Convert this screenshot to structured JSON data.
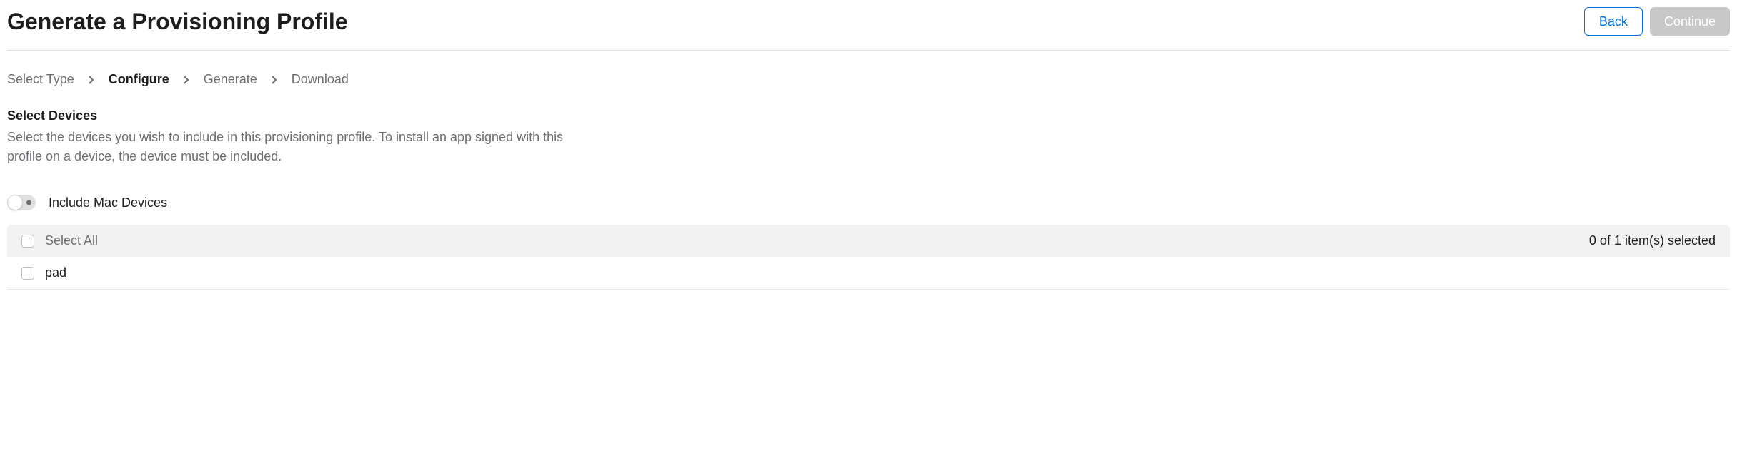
{
  "header": {
    "title": "Generate a Provisioning Profile",
    "back_label": "Back",
    "continue_label": "Continue"
  },
  "breadcrumb": {
    "items": [
      {
        "label": "Select Type",
        "active": false
      },
      {
        "label": "Configure",
        "active": true
      },
      {
        "label": "Generate",
        "active": false
      },
      {
        "label": "Download",
        "active": false
      }
    ]
  },
  "section": {
    "title": "Select Devices",
    "description": "Select the devices you wish to include in this provisioning profile. To install an app signed with this profile on a device, the device must be included."
  },
  "toggle": {
    "label": "Include Mac Devices",
    "on": false
  },
  "list": {
    "select_all_label": "Select All",
    "selection_count": "0 of 1 item(s) selected",
    "items": [
      {
        "label": "pad",
        "checked": false
      }
    ]
  }
}
